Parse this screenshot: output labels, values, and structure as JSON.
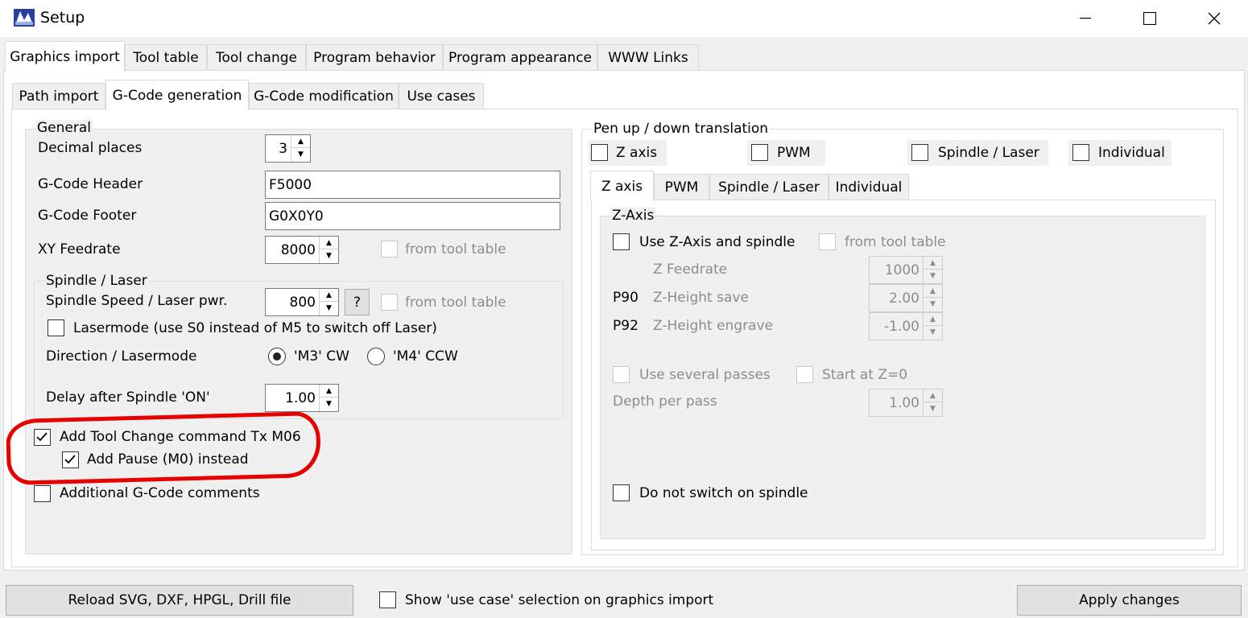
{
  "window": {
    "title": "Setup"
  },
  "main_tabs": [
    "Graphics import",
    "Tool table",
    "Tool change",
    "Program behavior",
    "Program appearance",
    "WWW Links"
  ],
  "sub_tabs": [
    "Path import",
    "G-Code generation",
    "G-Code modification",
    "Use cases"
  ],
  "general": {
    "legend": "General",
    "decimal_places_label": "Decimal places",
    "decimal_places_value": "3",
    "header_label": "G-Code Header",
    "header_value": "F5000",
    "footer_label": "G-Code Footer",
    "footer_value": "G0X0Y0",
    "xy_feedrate_label": "XY Feedrate",
    "xy_feedrate_value": "8000",
    "from_tool_table": "from tool table",
    "spindle": {
      "legend": "Spindle / Laser",
      "speed_label": "Spindle Speed / Laser pwr.",
      "speed_value": "800",
      "help_button": "?",
      "from_tool_table": "from tool table",
      "lasermode_label": "Lasermode (use S0 instead of M5 to switch off Laser)",
      "direction_label": "Direction / Lasermode",
      "m3_label": "'M3' CW",
      "m4_label": "'M4' CCW",
      "delay_label": "Delay after Spindle 'ON'",
      "delay_value": "1.00"
    },
    "tool_change_label": "Add Tool Change command Tx M06",
    "pause_label": "Add Pause (M0) instead",
    "comments_label": "Additional G-Code comments"
  },
  "pen": {
    "legend": "Pen up / down translation",
    "options": [
      "Z axis",
      "PWM",
      "Spindle / Laser",
      "Individual"
    ],
    "tabs": [
      "Z axis",
      "PWM",
      "Spindle / Laser",
      "Individual"
    ],
    "zaxis": {
      "legend": "Z-Axis",
      "use_z_label": "Use Z-Axis and spindle",
      "from_tool_table": "from tool table",
      "feedrate_label": "Z Feedrate",
      "feedrate_value": "1000",
      "p90": "P90",
      "height_save_label": "Z-Height save",
      "height_save_value": "2.00",
      "p92": "P92",
      "height_engrave_label": "Z-Height engrave",
      "height_engrave_value": "-1.00",
      "several_passes_label": "Use several passes",
      "start_at_z0_label": "Start at Z=0",
      "depth_label": "Depth per pass",
      "depth_value": "1.00",
      "no_spindle_label": "Do not switch on spindle"
    }
  },
  "bottom": {
    "reload_button": "Reload SVG, DXF, HPGL, Drill file",
    "show_use_case_label": "Show 'use case' selection on graphics import",
    "apply_button": "Apply changes"
  },
  "colors": {
    "annotation_ring": "#e60000",
    "window_bg": "#f0f0f0"
  }
}
